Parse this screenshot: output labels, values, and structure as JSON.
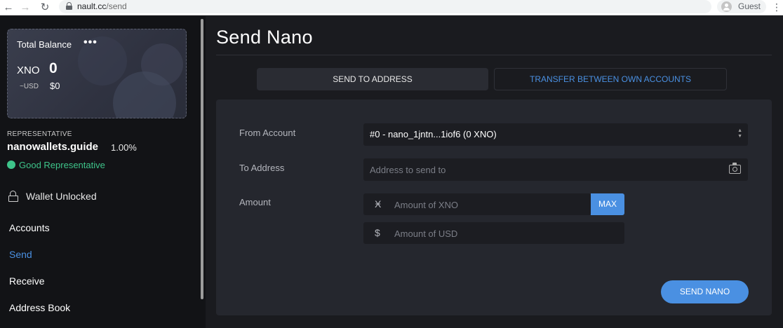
{
  "browser": {
    "url_host": "nault.cc",
    "url_path": "/send",
    "profile_name": "Guest",
    "back_icon": "←",
    "forward_icon": "→",
    "reload_icon": "↻",
    "menu_icon": "⋮"
  },
  "sidebar": {
    "balance": {
      "label": "Total Balance",
      "more_icon": "•••",
      "unit": "XNO",
      "value": "0",
      "fiat_unit": "~USD",
      "fiat_value": "$0"
    },
    "representative": {
      "label": "REPRESENTATIVE",
      "name": "nanowallets.guide",
      "percent": "1.00%",
      "status": "Good Representative",
      "status_color": "#3ec48a"
    },
    "wallet_status": "Wallet Unlocked",
    "nav": {
      "accounts": "Accounts",
      "send": "Send",
      "receive": "Receive",
      "address_book": "Address Book"
    }
  },
  "main": {
    "title": "Send Nano",
    "tabs": {
      "send_to_address": "SEND TO ADDRESS",
      "transfer": "TRANSFER BETWEEN OWN ACCOUNTS"
    },
    "form": {
      "from_label": "From Account",
      "from_value": "#0 - nano_1jntn...1iof6 (0 XNO)",
      "to_label": "To Address",
      "to_placeholder": "Address to send to",
      "amount_label": "Amount",
      "xno_prefix": "Ӿ",
      "xno_placeholder": "Amount of XNO",
      "max_label": "MAX",
      "usd_prefix": "$",
      "usd_placeholder": "Amount of USD",
      "send_label": "SEND NANO"
    }
  },
  "colors": {
    "accent": "#4a90e2",
    "success": "#3ec48a",
    "background": "#1a1b1f",
    "sidebar": "#121316",
    "panel": "#25272e"
  }
}
